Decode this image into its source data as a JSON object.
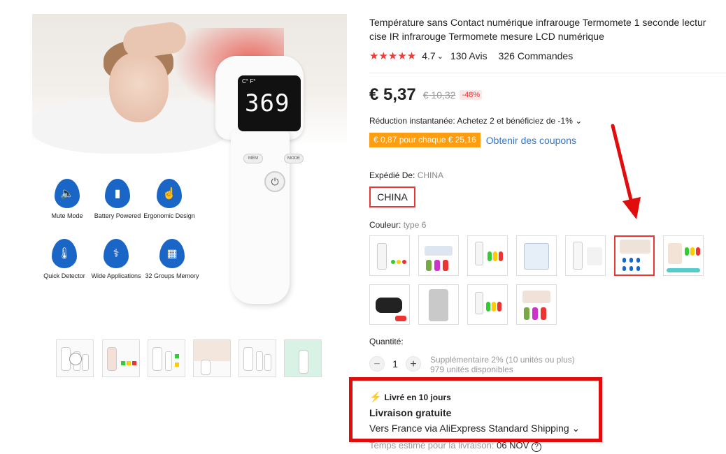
{
  "main_image": {
    "reading": "369",
    "cf": "C°  F°",
    "buttons": {
      "mem": "MEM",
      "mode": "MODE",
      "power": "⏻"
    },
    "features": [
      {
        "label": "Mute Mode",
        "icon": "🔈"
      },
      {
        "label": "Battery Powered",
        "icon": "▮"
      },
      {
        "label": "Ergonomic Design",
        "icon": "☝"
      },
      {
        "label": "Quick Detector",
        "icon": "🌡"
      },
      {
        "label": "Wide Applications",
        "icon": "⚕"
      },
      {
        "label": "32 Groups Memory",
        "icon": "▦"
      }
    ]
  },
  "product": {
    "title_line1": "Température sans Contact numérique infrarouge Termomete 1 seconde lectur",
    "title_line2": "cise IR infrarouge Termomete mesure LCD numérique",
    "rating_value": "4.7",
    "rating_caret": "⌄",
    "stars": "★★★★★",
    "reviews": "130 Avis",
    "orders": "326 Commandes"
  },
  "price": {
    "current": "€ 5,37",
    "original": "€ 10,32",
    "discount": "-48%"
  },
  "promo": {
    "instant": "Réduction instantanée: Achetez 2 et bénéficiez de -1% ⌄",
    "coupon": "€ 0,87 pour chaque € 25,16",
    "coupon_link": "Obtenir des coupons"
  },
  "ship_from": {
    "label": "Expédié De:",
    "value": "CHINA",
    "option": "CHINA"
  },
  "color": {
    "label": "Couleur:",
    "value": "type 6",
    "swatch_count": 11,
    "selected_index": 5
  },
  "quantity": {
    "label": "Quantité:",
    "minus": "−",
    "plus": "+",
    "value": "1",
    "extra": "Supplémentaire 2% (10 unités ou plus)",
    "available": "979 unités disponibles"
  },
  "delivery": {
    "fast": "Livré en 10 jours",
    "free": "Livraison gratuite",
    "via": "Vers France via AliExpress Standard Shipping ⌄",
    "estimate_label": "Temps estimé pour la livraison:",
    "estimate_date": "06 NOV",
    "help_icon": "?"
  },
  "colors": {
    "accent_red": "#e10d0d",
    "star_red": "#ee3d39",
    "coupon_orange": "#fd9d11",
    "link_blue": "#2e79d7"
  }
}
